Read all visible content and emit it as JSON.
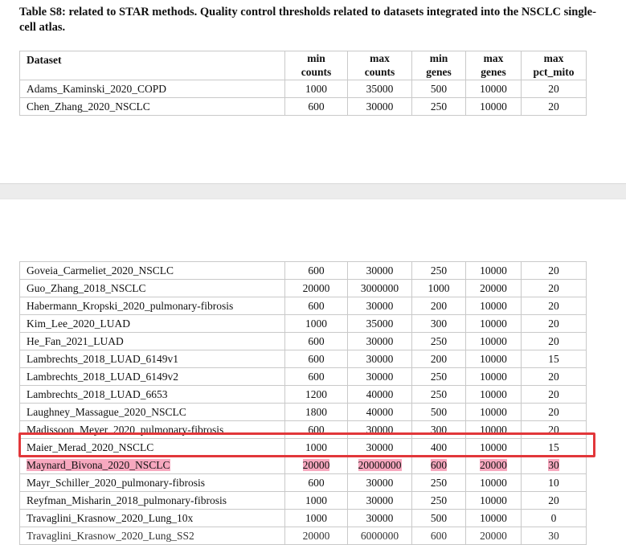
{
  "title": "Table S8: related to STAR methods. Quality control thresholds related to datasets integrated into the NSCLC single-cell atlas.",
  "columns": [
    {
      "line1": "Dataset",
      "line2": ""
    },
    {
      "line1": "min",
      "line2": "counts"
    },
    {
      "line1": "max",
      "line2": "counts"
    },
    {
      "line1": "min",
      "line2": "genes"
    },
    {
      "line1": "max",
      "line2": "genes"
    },
    {
      "line1": "max",
      "line2": "pct_mito"
    }
  ],
  "top_rows": [
    {
      "dataset": "Adams_Kaminski_2020_COPD",
      "min_counts": "1000",
      "max_counts": "35000",
      "min_genes": "500",
      "max_genes": "10000",
      "max_pct_mito": "20"
    },
    {
      "dataset": "Chen_Zhang_2020_NSCLC",
      "min_counts": "600",
      "max_counts": "30000",
      "min_genes": "250",
      "max_genes": "10000",
      "max_pct_mito": "20"
    }
  ],
  "bottom_rows": [
    {
      "dataset": "Goveia_Carmeliet_2020_NSCLC",
      "min_counts": "600",
      "max_counts": "30000",
      "min_genes": "250",
      "max_genes": "10000",
      "max_pct_mito": "20"
    },
    {
      "dataset": "Guo_Zhang_2018_NSCLC",
      "min_counts": "20000",
      "max_counts": "3000000",
      "min_genes": "1000",
      "max_genes": "20000",
      "max_pct_mito": "20"
    },
    {
      "dataset": "Habermann_Kropski_2020_pulmonary-fibrosis",
      "min_counts": "600",
      "max_counts": "30000",
      "min_genes": "200",
      "max_genes": "10000",
      "max_pct_mito": "20"
    },
    {
      "dataset": "Kim_Lee_2020_LUAD",
      "min_counts": "1000",
      "max_counts": "35000",
      "min_genes": "300",
      "max_genes": "10000",
      "max_pct_mito": "20"
    },
    {
      "dataset": "He_Fan_2021_LUAD",
      "min_counts": "600",
      "max_counts": "30000",
      "min_genes": "250",
      "max_genes": "10000",
      "max_pct_mito": "20"
    },
    {
      "dataset": "Lambrechts_2018_LUAD_6149v1",
      "min_counts": "600",
      "max_counts": "30000",
      "min_genes": "200",
      "max_genes": "10000",
      "max_pct_mito": "15"
    },
    {
      "dataset": "Lambrechts_2018_LUAD_6149v2",
      "min_counts": "600",
      "max_counts": "30000",
      "min_genes": "250",
      "max_genes": "10000",
      "max_pct_mito": "20"
    },
    {
      "dataset": "Lambrechts_2018_LUAD_6653",
      "min_counts": "1200",
      "max_counts": "40000",
      "min_genes": "250",
      "max_genes": "10000",
      "max_pct_mito": "20"
    },
    {
      "dataset": "Laughney_Massague_2020_NSCLC",
      "min_counts": "1800",
      "max_counts": "40000",
      "min_genes": "500",
      "max_genes": "10000",
      "max_pct_mito": "20"
    },
    {
      "dataset": "Madissoon_Meyer_2020_pulmonary-fibrosis",
      "min_counts": "600",
      "max_counts": "30000",
      "min_genes": "300",
      "max_genes": "10000",
      "max_pct_mito": "20"
    },
    {
      "dataset": "Maier_Merad_2020_NSCLC",
      "min_counts": "1000",
      "max_counts": "30000",
      "min_genes": "400",
      "max_genes": "10000",
      "max_pct_mito": "15"
    },
    {
      "dataset": "Maynard_Bivona_2020_NSCLC",
      "min_counts": "20000",
      "max_counts": "20000000",
      "min_genes": "600",
      "max_genes": "20000",
      "max_pct_mito": "30"
    },
    {
      "dataset": "Mayr_Schiller_2020_pulmonary-fibrosis",
      "min_counts": "600",
      "max_counts": "30000",
      "min_genes": "250",
      "max_genes": "10000",
      "max_pct_mito": "10"
    },
    {
      "dataset": "Reyfman_Misharin_2018_pulmonary-fibrosis",
      "min_counts": "1000",
      "max_counts": "30000",
      "min_genes": "250",
      "max_genes": "10000",
      "max_pct_mito": "20"
    },
    {
      "dataset": "Travaglini_Krasnow_2020_Lung_10x",
      "min_counts": "1000",
      "max_counts": "30000",
      "min_genes": "500",
      "max_genes": "10000",
      "max_pct_mito": "0"
    },
    {
      "dataset": "Travaglini_Krasnow_2020_Lung_SS2",
      "min_counts": "20000",
      "max_counts": "6000000",
      "min_genes": "600",
      "max_genes": "20000",
      "max_pct_mito": "30"
    }
  ],
  "highlight_color": "#f7a8bf",
  "box_color": "#e2373a"
}
